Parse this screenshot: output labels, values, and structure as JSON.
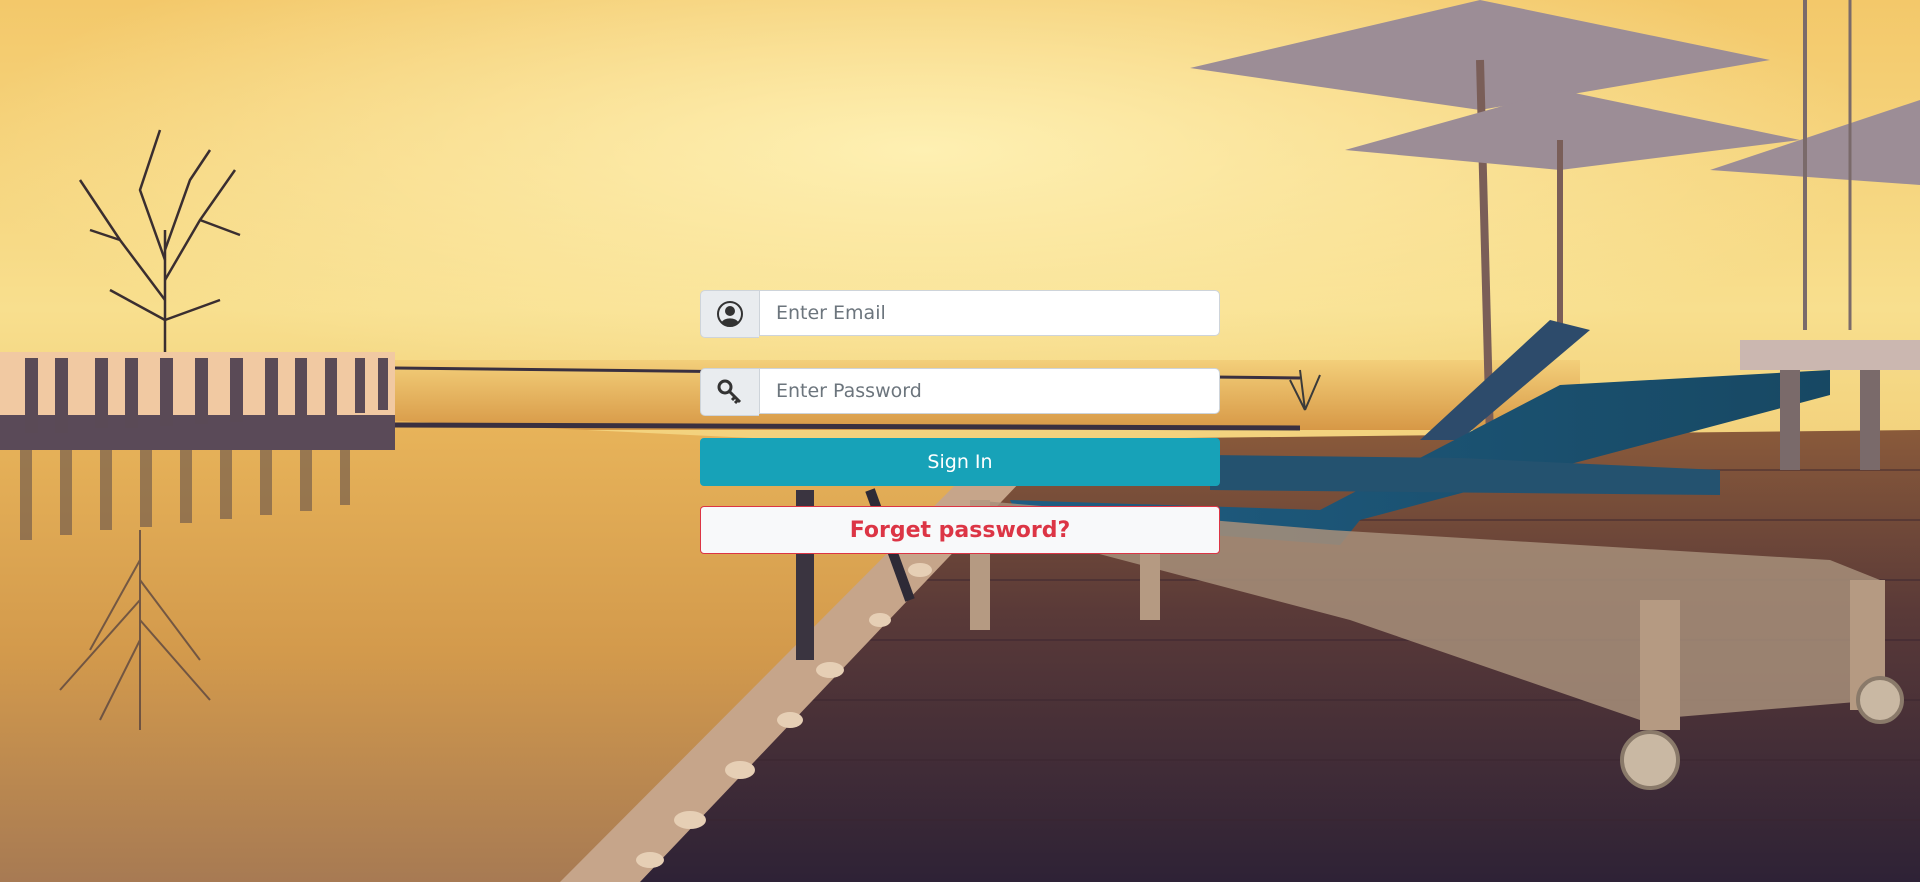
{
  "login": {
    "email_placeholder": "Enter Email",
    "password_placeholder": "Enter Password",
    "signin_label": "Sign In",
    "forget_label": "Forget password?"
  },
  "icons": {
    "email_icon": "user-circle-icon",
    "password_icon": "key-icon"
  },
  "colors": {
    "signin_bg": "#17a2b8",
    "forget_text": "#dc3545",
    "sky_top": "#f6d77e",
    "sky_mid": "#f9e59a",
    "deck_dark": "#3a2a35"
  }
}
